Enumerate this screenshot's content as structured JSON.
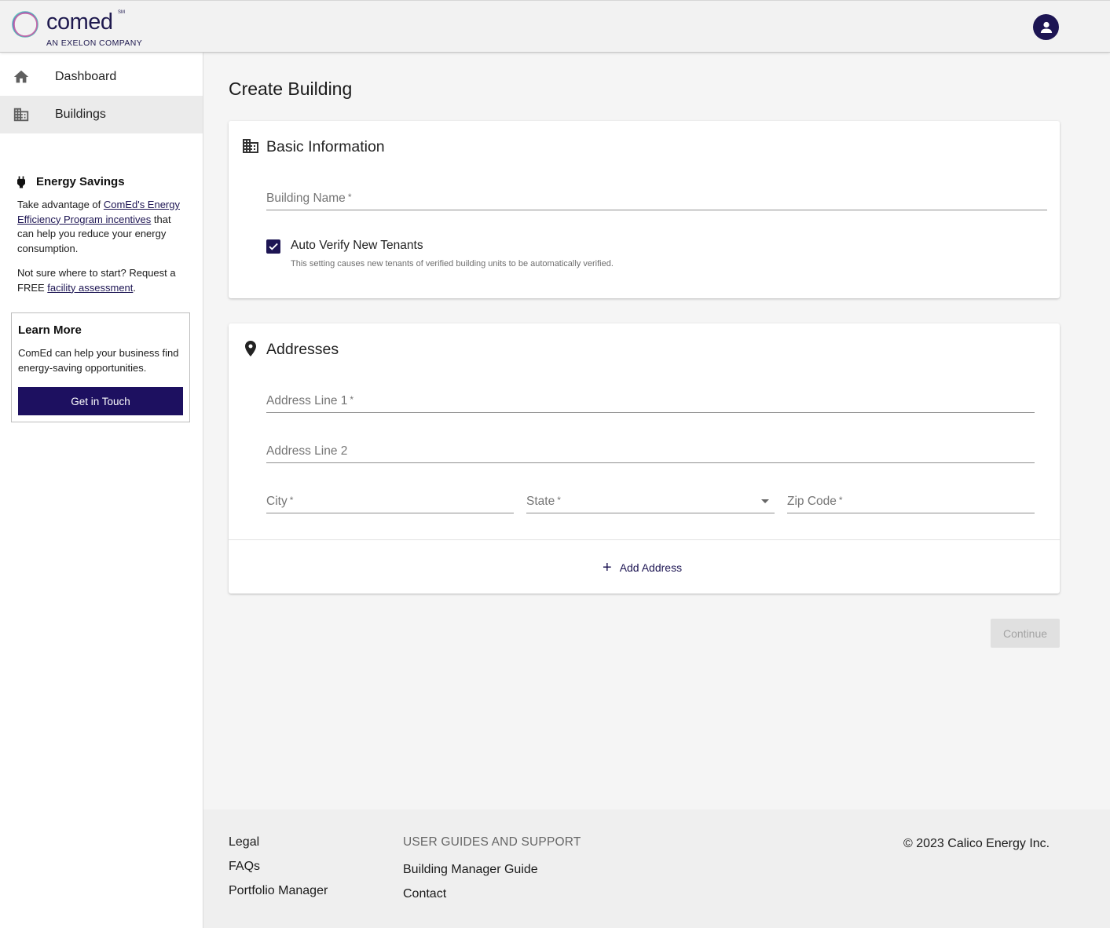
{
  "header": {
    "brand": "comed",
    "brand_mark": "SM",
    "tagline": "AN EXELON COMPANY",
    "user_icon": "account-circle-icon"
  },
  "sidebar": {
    "items": [
      {
        "label": "Dashboard",
        "icon": "home-icon",
        "active": false
      },
      {
        "label": "Buildings",
        "icon": "building-icon",
        "active": true
      }
    ],
    "energy_savings": {
      "title": "Energy Savings",
      "icon": "plug-icon",
      "p1_prefix": "Take advantage of ",
      "p1_link": "ComEd's Energy Efficiency Program incentives",
      "p1_suffix": " that can help you reduce your energy consumption.",
      "p2_prefix": "Not sure where to start? Request a FREE ",
      "p2_link": "facility assessment",
      "p2_suffix": "."
    },
    "learn_more": {
      "title": "Learn More",
      "text": "ComEd can help your business find energy-saving opportunities.",
      "button": "Get in Touch"
    }
  },
  "main": {
    "title": "Create Building",
    "basic": {
      "title": "Basic Information",
      "icon": "building-icon",
      "building_name_placeholder": "Building Name",
      "required_mark": "*",
      "auto_verify_label": "Auto Verify New Tenants",
      "auto_verify_checked": true,
      "auto_verify_help": "This setting causes new tenants of verified building units to be automatically verified."
    },
    "addresses": {
      "title": "Addresses",
      "icon": "location-pin-icon",
      "line1_placeholder": "Address Line 1",
      "line2_placeholder": "Address Line 2",
      "city_placeholder": "City",
      "state_placeholder": "State",
      "zip_placeholder": "Zip Code",
      "required_mark": "*",
      "add_label": "Add Address"
    },
    "continue_label": "Continue"
  },
  "footer": {
    "links": [
      "Legal",
      "FAQs",
      "Portfolio Manager"
    ],
    "support_heading": "USER GUIDES AND SUPPORT",
    "support_links": [
      "Building Manager Guide",
      "Contact"
    ],
    "copyright": "© 2023 Calico Energy Inc."
  },
  "colors": {
    "brand": "#1d1553",
    "button_primary": "#1d1060",
    "button_disabled": "#e0e0e0"
  }
}
